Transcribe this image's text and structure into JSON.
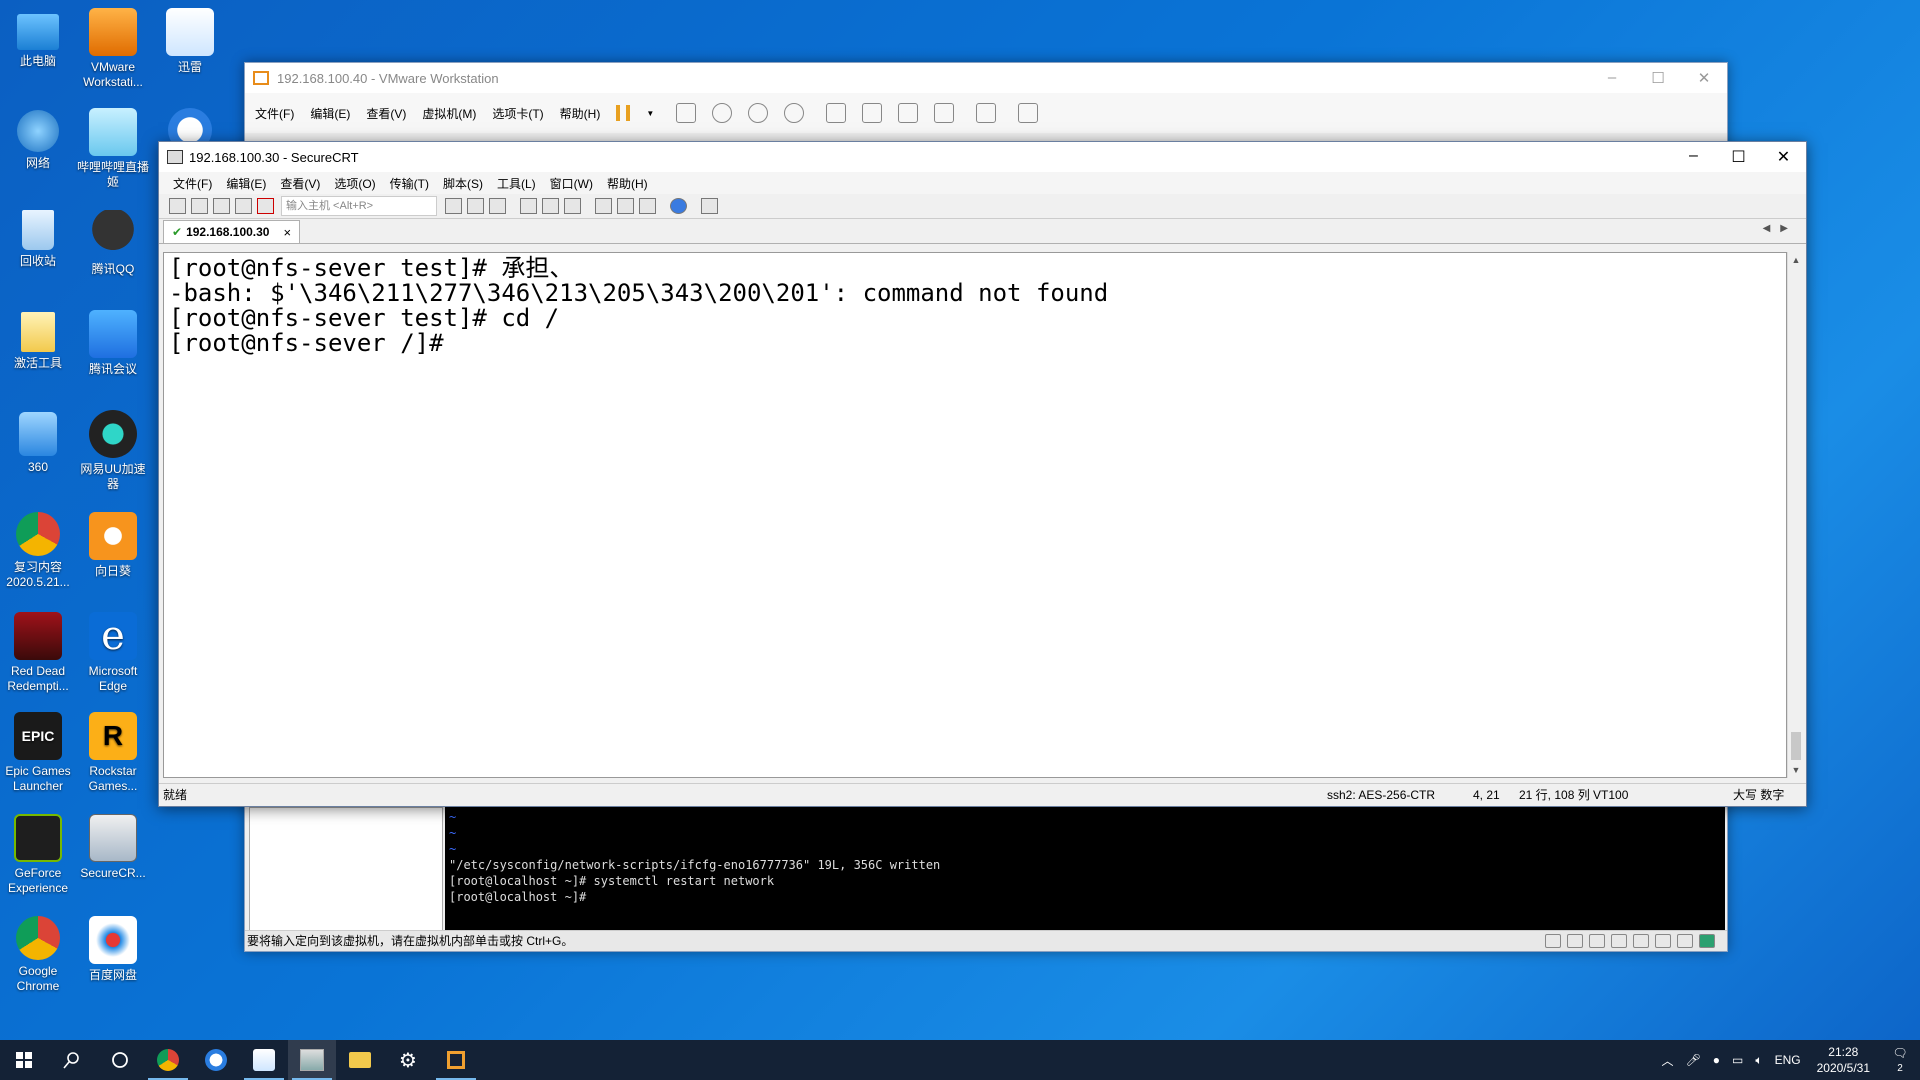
{
  "desktop": {
    "icons_col1": [
      "此电脑",
      "网络",
      "回收站",
      "激活工具",
      "360",
      "复习内容\n2020.5.21...",
      "Red Dead\nRedempti...",
      "Epic Games\nLauncher",
      "GeForce\nExperience",
      "Google\nChrome"
    ],
    "icons_col2": [
      "VMware\nWorkstati...",
      "哔哩哔哩直播\n姬",
      "腾讯QQ",
      "腾讯会议",
      "网易UU加速\n器",
      "向日葵",
      "Microsoft\nEdge",
      "Rockstar\nGames...",
      "SecureCR...",
      "百度网盘"
    ],
    "icons_col3": [
      "迅雷"
    ]
  },
  "vmware": {
    "title": "192.168.100.40 - VMware Workstation",
    "menu": [
      "文件(F)",
      "编辑(E)",
      "查看(V)",
      "虚拟机(M)",
      "选项卡(T)",
      "帮助(H)"
    ],
    "console_lines": [
      "~",
      "~",
      "~",
      "\"/etc/sysconfig/network-scripts/ifcfg-eno16777736\" 19L, 356C written",
      "[root@localhost ~]# systemctl restart network",
      "[root@localhost ~]#"
    ],
    "status_text": "要将输入定向到该虚拟机，请在虚拟机内部单击或按 Ctrl+G。"
  },
  "crt": {
    "title": "192.168.100.30 - SecureCRT",
    "menu": [
      "文件(F)",
      "编辑(E)",
      "查看(V)",
      "选项(O)",
      "传输(T)",
      "脚本(S)",
      "工具(L)",
      "窗口(W)",
      "帮助(H)"
    ],
    "host_placeholder": "输入主机 <Alt+R>",
    "tab_label": "192.168.100.30",
    "terminal_lines": [
      "[root@nfs-sever test]# 承担、",
      "-bash: $'\\346\\211\\277\\346\\213\\205\\343\\200\\201': command not found",
      "[root@nfs-sever test]# cd /",
      "[root@nfs-sever /]# "
    ],
    "status": {
      "ready": "就绪",
      "cipher": "ssh2: AES-256-CTR",
      "cursor": "4,  21",
      "size": "21 行, 108 列 VT100",
      "keys": "大写  数字"
    }
  },
  "taskbar": {
    "lang": "ENG",
    "time": "21:28",
    "date": "2020/5/31",
    "notifications": "2"
  },
  "colors": {
    "desktop": "#0a74d6",
    "taskbar": "#142236",
    "terminal_bg": "#ffffff",
    "vm_console_bg": "#000000"
  }
}
